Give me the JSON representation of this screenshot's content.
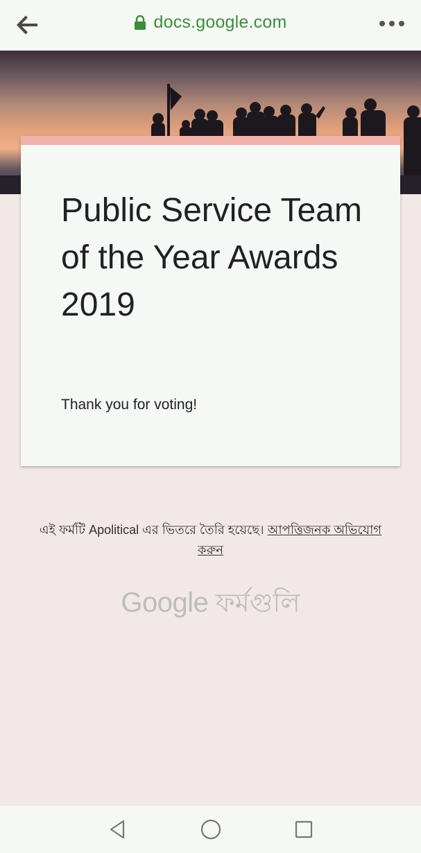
{
  "browser": {
    "url": "docs.google.com",
    "back_icon": "arrow-left-icon",
    "lock_icon": "lock-icon",
    "menu_icon": "more-horiz-icon",
    "url_color": "#3a8d3a"
  },
  "form": {
    "title": "Public Service Team of the Year Awards 2019",
    "confirmation": "Thank you for voting!",
    "accent_color": "#f2b3ab"
  },
  "footer": {
    "created_text": "এই ফর্মটি Apolitical এর ভিতরে তৈরি হয়েছে।",
    "report_link": "আপত্তিজনক অভিযোগ করুন",
    "brand_google": "Google",
    "brand_forms": "ফর্মগুলি"
  },
  "android_nav": {
    "back_icon": "triangle-back-icon",
    "home_icon": "circle-home-icon",
    "recents_icon": "square-recents-icon"
  }
}
